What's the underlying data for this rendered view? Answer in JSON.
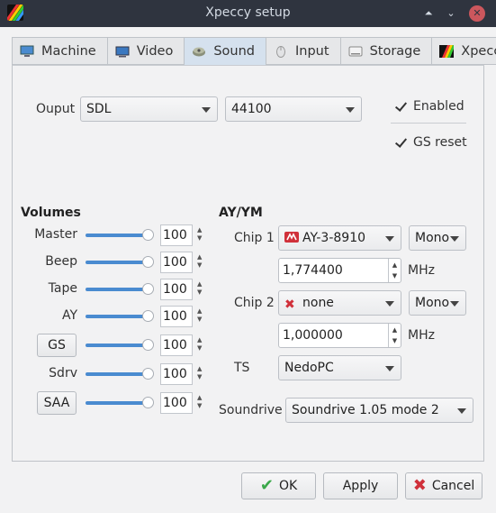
{
  "window": {
    "title": "Xpeccy setup",
    "controls": [
      "⏶",
      "⌄",
      "✕"
    ]
  },
  "tabs": [
    {
      "label": "Machine",
      "icon": "monitor-icon",
      "active": false
    },
    {
      "label": "Video",
      "icon": "display-icon",
      "active": false
    },
    {
      "label": "Sound",
      "icon": "speaker-icon",
      "active": true
    },
    {
      "label": "Input",
      "icon": "mouse-icon",
      "active": false
    },
    {
      "label": "Storage",
      "icon": "drive-icon",
      "active": false
    },
    {
      "label": "Xpeccy",
      "icon": "xpeccy-logo-icon",
      "active": false
    }
  ],
  "output": {
    "label": "Ouput",
    "device": "SDL",
    "rate": "44100",
    "enabled_label": "Enabled",
    "enabled": true,
    "gs_reset_label": "GS reset",
    "gs_reset": true
  },
  "volumes": {
    "heading": "Volumes",
    "rows": [
      {
        "label": "Master",
        "value": "100",
        "level": 1.0,
        "button": false
      },
      {
        "label": "Beep",
        "value": "100",
        "level": 1.0,
        "button": false
      },
      {
        "label": "Tape",
        "value": "100",
        "level": 1.0,
        "button": false
      },
      {
        "label": "AY",
        "value": "100",
        "level": 1.0,
        "button": false
      },
      {
        "label": "GS",
        "value": "100",
        "level": 1.0,
        "button": true
      },
      {
        "label": "Sdrv",
        "value": "100",
        "level": 1.0,
        "button": false
      },
      {
        "label": "SAA",
        "value": "100",
        "level": 1.0,
        "button": true
      }
    ]
  },
  "ay": {
    "heading": "AY/YM",
    "chip1": {
      "label": "Chip 1",
      "type": "AY-3-8910",
      "mode": "Mono",
      "freq": "1,774400",
      "unit": "MHz"
    },
    "chip2": {
      "label": "Chip 2",
      "type": "none",
      "mode": "Mono",
      "freq": "1,000000",
      "unit": "MHz"
    },
    "ts": {
      "label": "TS",
      "value": "NedoPC"
    },
    "soundrive": {
      "label": "Soundrive",
      "value": "Soundrive 1.05 mode 2"
    }
  },
  "buttons": {
    "ok": "OK",
    "apply": "Apply",
    "cancel": "Cancel"
  },
  "colors": {
    "titlebar": "#2f343f",
    "accent": "#4a8bd0",
    "close": "#cc575d",
    "active_tab": "#d5e1ee",
    "ok_check": "#3aa84a",
    "cancel_x": "#d0303a"
  }
}
